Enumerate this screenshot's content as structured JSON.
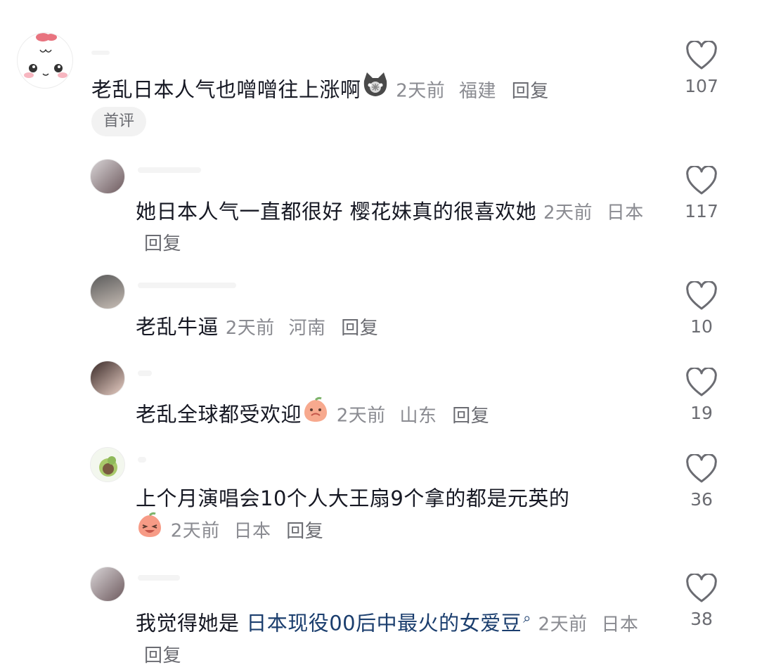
{
  "comments": [
    {
      "text": "老乱日本人气也噌噌往上涨啊",
      "time": "2天前",
      "location": "福建",
      "reply": "回复",
      "badge": "首评",
      "likes": "107",
      "emoji": "cat-emoji"
    },
    {
      "text": "她日本人气一直都很好  樱花妹真的很喜欢她",
      "time": "2天前",
      "location": "日本",
      "reply": "回复",
      "likes": "117"
    },
    {
      "text": "老乱牛逼",
      "time": "2天前",
      "location": "河南",
      "reply": "回复",
      "likes": "10"
    },
    {
      "text": "老乱全球都受欢迎",
      "time": "2天前",
      "location": "山东",
      "reply": "回复",
      "likes": "19",
      "emoji": "peach-face-emoji"
    },
    {
      "text": "上个月演唱会10个人大王扇9个拿的都是元英的",
      "time": "2天前",
      "location": "日本",
      "reply": "回复",
      "likes": "36",
      "emoji": "peach-laugh-emoji"
    },
    {
      "text_prefix": "我觉得她是 ",
      "link_text": "日本现役00后中最火的女爱豆",
      "time": "2天前",
      "location": "日本",
      "reply": "回复",
      "likes": "38"
    }
  ],
  "colors": {
    "text": "#161823",
    "meta": "#8a8b91",
    "link": "#1b3e6e",
    "badge_bg": "#f2f2f2"
  }
}
